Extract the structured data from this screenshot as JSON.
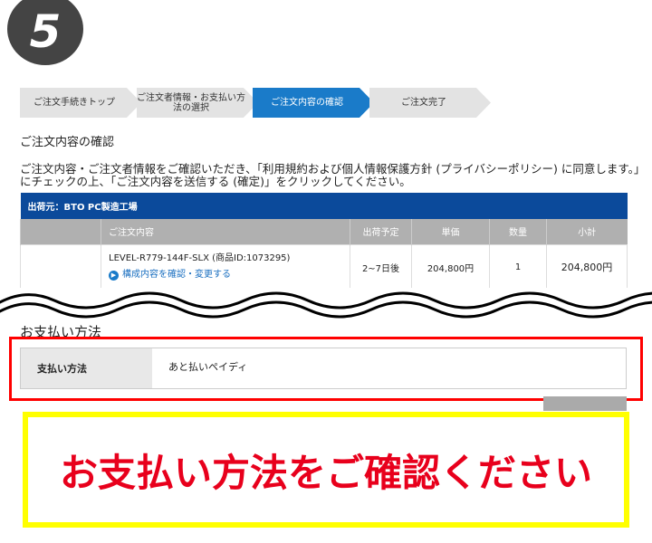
{
  "step_number": "5",
  "steps": [
    "ご注文手続きトップ",
    "ご注文者情報・お支払い方法の選択",
    "ご注文内容の確認",
    "ご注文完了"
  ],
  "heading": "ご注文内容の確認",
  "description": "ご注文内容・ご注文者情報をご確認いただき、「利用規約および個人情報保護方針 (プライバシーポリシー) に同意します。」にチェックの上、「ご注文内容を送信する (確定)」をクリックしてください。",
  "table": {
    "ship_from": "出荷元：BTO PC製造工場",
    "headers": [
      "ご注文内容",
      "出荷予定",
      "単価",
      "数量",
      "小計"
    ],
    "row": {
      "product": "LEVEL-R779-144F-SLX (商品ID:1073295)",
      "link": "構成内容を確認・変更する",
      "ship": "2~7日後",
      "price": "204,800円",
      "qty": "1",
      "subtotal": "204,800円"
    }
  },
  "payment": {
    "heading": "お支払い方法",
    "label": "支払い方法",
    "value": "あと払いペイディ"
  },
  "callout": "お支払い方法をご確認ください"
}
